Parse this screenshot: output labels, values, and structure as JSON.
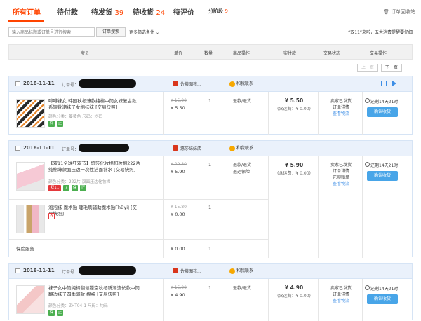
{
  "tabs": [
    {
      "label": "所有订单",
      "count": ""
    },
    {
      "label": "待付款",
      "count": ""
    },
    {
      "label": "待发货",
      "count": "39"
    },
    {
      "label": "待收货",
      "count": "24"
    },
    {
      "label": "待评价",
      "count": ""
    },
    {
      "label": "分阶段",
      "count": "9"
    }
  ],
  "recycle_label": "订单回收站",
  "search": {
    "placeholder": "输入商品标题或订单号进行搜索",
    "button": "订单搜索",
    "more_filter": "更多筛选条件"
  },
  "notice": "“双11”来啦，五大消费提醒要仔细",
  "columns": [
    "宝贝",
    "单价",
    "数量",
    "商品操作",
    "实付款",
    "交易状态",
    "交易操作"
  ],
  "pager": {
    "prev": "上一页",
    "next": "下一页"
  },
  "colors": {
    "accent": "#ff4400",
    "link": "#3d8ee6",
    "button": "#48a5e8"
  },
  "orders": [
    {
      "date": "2016-11-11",
      "order_no_label": "订单号：",
      "shop": "佐藤图孩...",
      "contact": "和我联系",
      "items": [
        {
          "title": "啡啡袜女 韩国秋冬薄款纯棉中筒女袜复古款系短靴潮袜子女棉袜袜 [交易快照]",
          "meta": "颜色分类：姜黄色  尺码：均码",
          "orig_price": "¥ 15.00",
          "price": "¥ 5.50",
          "qty": "1",
          "ops": [
            "退款/退货"
          ]
        }
      ],
      "total": "¥ 5.50",
      "shipping": "(含运费：¥ 0.00)",
      "status": [
        "卖家已发货",
        "订单详情",
        "查看物流"
      ],
      "countdown": "还剩14天21时",
      "confirm": "确认收货"
    },
    {
      "date": "2016-11-11",
      "order_no_label": "订单号：",
      "shop": "悠莎妹妹店",
      "contact": "和我联系",
      "items": [
        {
          "title": "【双11全球狂欢节】悠莎化妆棉卸妆棉222片 纯棉薄款面压边一次性洁面补水 [交易快照]",
          "meta": "颜色分类：222片 双面压边化妆棉",
          "orig_price": "¥ 29.80",
          "price": "¥ 5.90",
          "qty": "1",
          "ops": [
            "退款/退货",
            "退运保险"
          ]
        },
        {
          "title": "泡泡袜 魔术贴 睫毛刷辅助魔术贴FhByiJ [交易快照]",
          "meta": "",
          "orig_price": "¥ 15.80",
          "price": "¥ 0.00",
          "qty": "1",
          "ops": []
        },
        {
          "title": "保险服务",
          "meta": "",
          "orig_price": "",
          "price": "¥ 0.00",
          "qty": "1",
          "ops": []
        }
      ],
      "total": "¥ 5.90",
      "shipping": "(含运费：¥ 0.00)",
      "status": [
        "卖家已发货",
        "订单详情",
        "花呗账单",
        "查看物流"
      ],
      "countdown": "还剩14天21时",
      "confirm": "确认收货"
    },
    {
      "date": "2016-11-11",
      "order_no_label": "订单号：",
      "shop": "佐藤图孩...",
      "contact": "和我联系",
      "items": [
        {
          "title": "袜子女中筒纯棉翻领镂空秋冬新潮流长款中筒翻边袜子四季薄款 棉袜 [交易快照]",
          "meta": "颜色分类：ZHT04-1  尺码：均码",
          "orig_price": "¥ 15.00",
          "price": "¥ 4.90",
          "qty": "1",
          "ops": [
            "退款/退货"
          ]
        }
      ],
      "total": "¥ 4.90",
      "shipping": "(含运费：¥ 0.00)",
      "status": [
        "卖家已发货",
        "订单详情",
        "查看物流"
      ],
      "countdown": "还剩14天21时",
      "confirm": "确认收货"
    }
  ]
}
